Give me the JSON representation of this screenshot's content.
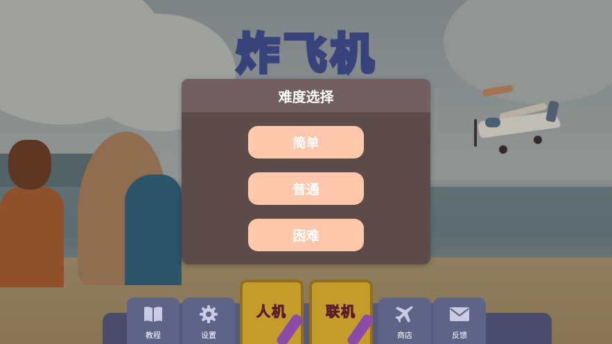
{
  "game_title": "炸飞机",
  "difficulty_dialog": {
    "title": "难度选择",
    "options": [
      "简单",
      "普通",
      "困难"
    ]
  },
  "bottom_bar": {
    "tutorial_label": "教程",
    "settings_label": "设置",
    "vs_ai_label": "人机",
    "online_label": "联机",
    "shop_label": "商店",
    "feedback_label": "反馈"
  },
  "colors": {
    "dialog_bg": "#5b4c4a",
    "dialog_header": "#725f5f",
    "option_button": "#ffc8ab",
    "mode_button": "#c39c2c",
    "bar": "#5e6488"
  },
  "icons": {
    "tutorial": "book-icon",
    "settings": "gear-icon",
    "shop": "airplane-icon",
    "feedback": "envelope-icon"
  }
}
